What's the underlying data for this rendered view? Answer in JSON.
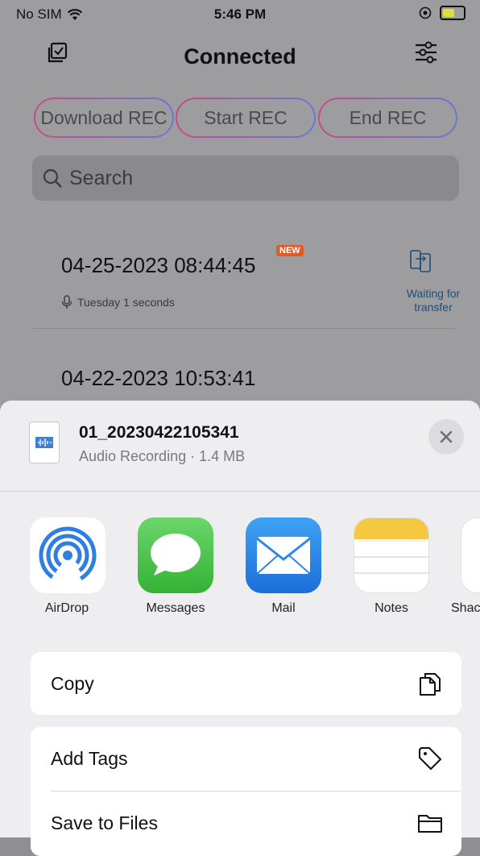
{
  "status": {
    "carrier": "No SIM",
    "time": "5:46 PM"
  },
  "nav": {
    "title": "Connected",
    "left_icon": "checklist-icon",
    "right_icon": "sliders-icon"
  },
  "rec_buttons": {
    "download": "Download REC",
    "start": "Start REC",
    "end": "End REC"
  },
  "search": {
    "placeholder": "Search"
  },
  "recordings": [
    {
      "date": "04-25-2023 08:44:45",
      "badge": "NEW",
      "sub": "Tuesday  1 seconds",
      "status": "Waiting for transfer"
    },
    {
      "date": "04-22-2023 10:53:41"
    }
  ],
  "share": {
    "file_name": "01_20230422105341",
    "file_meta": "Audio Recording · 1.4 MB",
    "apps": [
      {
        "label": "AirDrop",
        "icon": "airdrop-icon"
      },
      {
        "label": "Messages",
        "icon": "messages-icon"
      },
      {
        "label": "Mail",
        "icon": "mail-icon"
      },
      {
        "label": "Notes",
        "icon": "notes-icon"
      },
      {
        "label": "Shac",
        "icon": "shortcuts-icon"
      }
    ],
    "actions": [
      {
        "label": "Copy",
        "icon": "copy-icon"
      },
      {
        "label": "Add Tags",
        "icon": "tag-icon"
      },
      {
        "label": "Save to Files",
        "icon": "folder-icon"
      }
    ]
  }
}
